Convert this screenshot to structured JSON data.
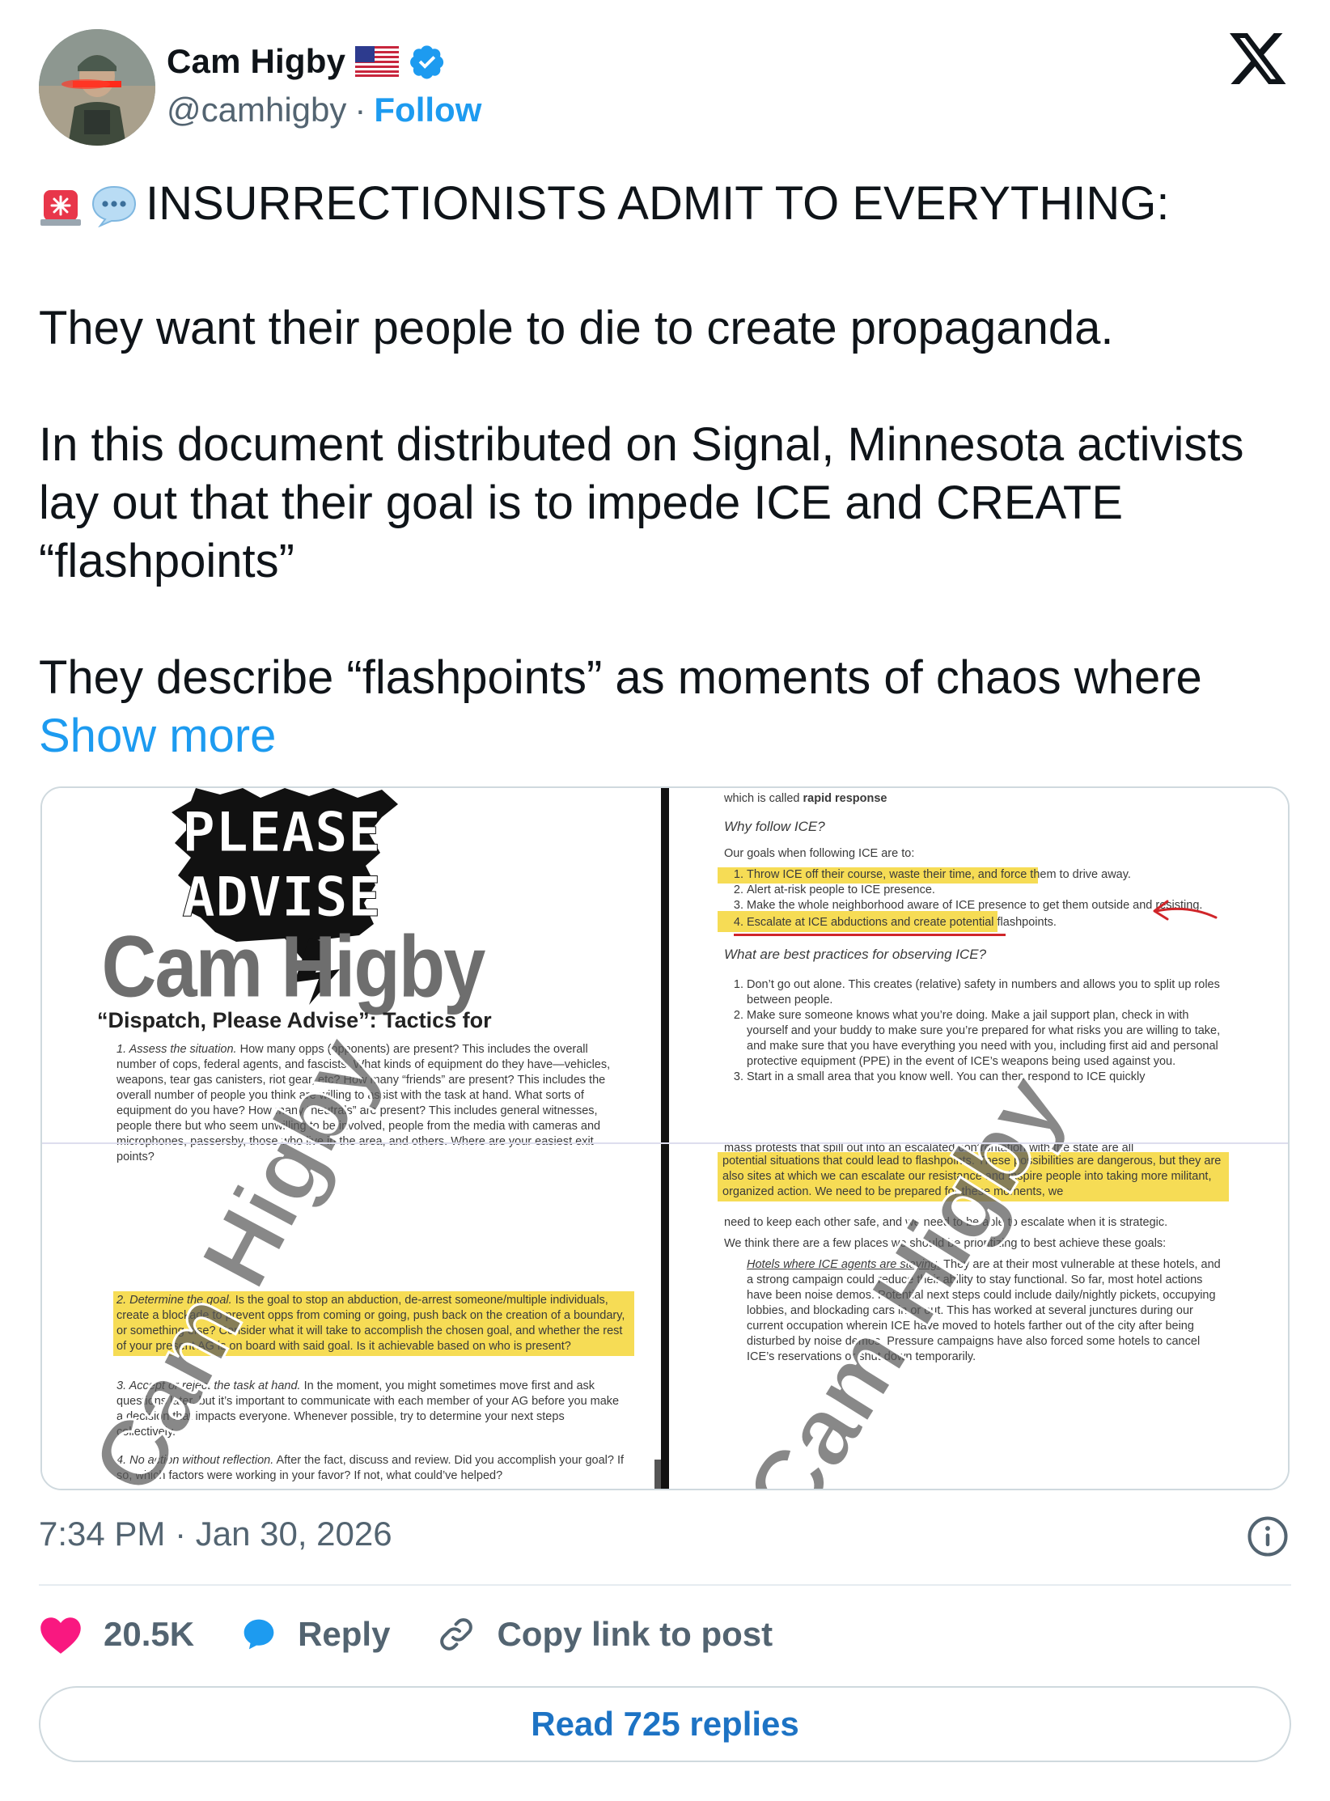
{
  "author": {
    "name": "Cam Higby",
    "handle": "@camhigby",
    "separator": "·",
    "follow_label": "Follow"
  },
  "icons": {
    "flag": "us-flag-icon",
    "verified": "verified-badge-icon",
    "platform": "x-logo-icon",
    "siren": "police-siren-icon",
    "speech": "speech-bubble-icon",
    "like": "heart-icon",
    "reply": "reply-bubble-icon",
    "copy": "link-icon",
    "info": "info-icon"
  },
  "tweet": {
    "headline": "INSURRECTIONISTS ADMIT TO EVERYTHING:",
    "para1": "They want their people to die to create propaganda.",
    "para2": "In this document distributed on Signal, Minnesota activists lay out that their goal is to impede ICE and CREATE “flashpoints”",
    "para3": "They describe “flashpoints” as moments of chaos where",
    "show_more": "Show more"
  },
  "media": {
    "left": {
      "poster_line1": "PLEASE",
      "poster_line2": "ADVISE",
      "watermark": "Cam Higby",
      "doc_title": "“Dispatch, Please Advise”: Tactics for",
      "item1_label": "1. Assess the situation.",
      "item1_text": "How many opps (opponents) are present? This includes the overall number of cops, federal agents, and fascists. What kinds of equipment do they have—vehicles, weapons, tear gas canisters, riot gear, etc? How many “friends” are present? This includes the overall number of people you think are willing to assist with the task at hand. What sorts of equipment do you have? How many “neutrals” are present? This includes general witnesses, people there but who seem unwilling to be involved, people from the media with cameras and microphones, passersby, those who live in the area, and others. Where are your easiest exit points?",
      "item2_label": "2. Determine the goal.",
      "item2_text": "Is the goal to stop an abduction, de-arrest someone/multiple individuals, create a blockade to prevent opps from coming or going, push back on the creation of a boundary, or something else? Consider what it will take to accomplish the chosen goal, and whether the rest of your present AG is on board with said goal. Is it achievable based on who is present?",
      "item3_label": "3. Accept or reject the task at hand.",
      "item3_text": "In the moment, you might sometimes move first and ask questions later, but it’s important to communicate with each member of your AG before you make a decision that impacts everyone. Whenever possible, try to determine your next steps collectively.",
      "item4_label": "4. No action without reflection.",
      "item4_text": "After the fact, discuss and review. Did you accomplish your goal? If so, which factors were working in your favor? If not, what could’ve helped?"
    },
    "right": {
      "top_line_a": "which is called ",
      "top_line_b": "rapid response",
      "heading1": "Why follow ICE?",
      "intro": "Our goals when following ICE are to:",
      "goals": [
        "Throw ICE off their course, waste their time, and force them to drive away.",
        "Alert at-risk people to ICE presence.",
        "Make the whole neighborhood aware of ICE presence to get them outside and resisting.",
        "Escalate at ICE abductions and create potential flashpoints."
      ],
      "heading2": "What are best practices for observing ICE?",
      "practices": [
        "Don’t go out alone. This creates (relative) safety in numbers and allows you to split up roles between people.",
        "Make sure someone knows what you’re doing. Make a jail support plan, check in with yourself and your buddy to make sure you’re prepared for what risks you are willing to take, and make sure that you have everything you need with you, including first aid and personal protective equipment (PPE) in the event of ICE’s weapons being used against you.",
        "Start in a small area that you know well. You can then respond to ICE quickly"
      ],
      "para_cut": "mass protests that spill out into an escalated confrontation with the state are all",
      "para_hl": "potential situations that could lead to flashpoints. These possibilities are dangerous, but they are also sites at which we can escalate our resistance and inspire people into taking more militant, organized action. We need to be prepared for these moments, we",
      "para_end": "need to keep each other safe, and we need to be able to escalate when it is strategic.",
      "para2": "We think there are a few places we should be prioritizing to best achieve these goals:",
      "hotel_label": "Hotels where ICE agents are staying.",
      "hotel_text": "They are at their most vulnerable at these hotels, and a strong campaign could reduce their ability to stay functional. So far, most hotel actions have been noise demos. Potential next steps could include daily/nightly pickets, occupying lobbies, and blockading cars in or out. This has worked at several junctures during our current occupation wherein ICE have moved to hotels farther out of the city after being disturbed by noise demos. Pressure campaigns have also forced some hotels to cancel ICE’s reservations or shut down temporarily."
    }
  },
  "footer": {
    "timestamp": "7:34 PM · Jan 30, 2026",
    "likes": "20.5K",
    "reply_label": "Reply",
    "copy_label": "Copy link to post",
    "read_replies": "Read 725 replies"
  },
  "colors": {
    "accent": "#1d9bf0",
    "like": "#f91880",
    "highlight": "#f6dc55",
    "arrow": "#d0262a"
  }
}
